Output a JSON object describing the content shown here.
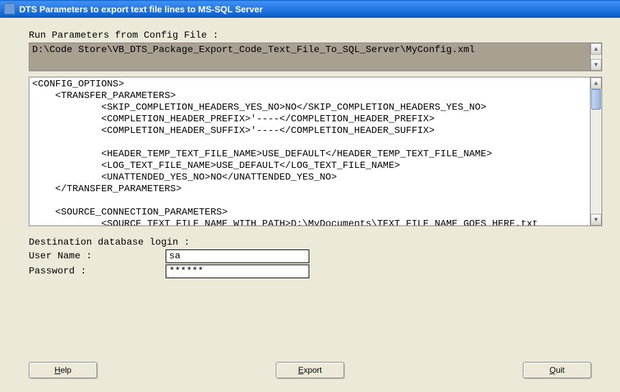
{
  "window": {
    "title": "DTS Parameters to export text file lines to MS-SQL Server"
  },
  "labels": {
    "run_params": "Run Parameters from Config File :",
    "dest_login": "Destination database login :",
    "user_name": "User Name :",
    "password": "Password :"
  },
  "config_path": "D:\\Code Store\\VB_DTS_Package_Export_Code_Text_File_To_SQL_Server\\MyConfig.xml",
  "xml_content": "<CONFIG_OPTIONS>\n    <TRANSFER_PARAMETERS>\n            <SKIP_COMPLETION_HEADERS_YES_NO>NO</SKIP_COMPLETION_HEADERS_YES_NO>\n            <COMPLETION_HEADER_PREFIX>'----</COMPLETION_HEADER_PREFIX>\n            <COMPLETION_HEADER_SUFFIX>'----</COMPLETION_HEADER_SUFFIX>\n\n            <HEADER_TEMP_TEXT_FILE_NAME>USE_DEFAULT</HEADER_TEMP_TEXT_FILE_NAME>\n            <LOG_TEXT_FILE_NAME>USE_DEFAULT</LOG_TEXT_FILE_NAME>\n            <UNATTENDED_YES_NO>NO</UNATTENDED_YES_NO>\n    </TRANSFER_PARAMETERS>\n\n    <SOURCE_CONNECTION_PARAMETERS>\n            <SOURCE_TEXT_FILE_NAME_WITH_PATH>D:\\MyDocuments\\TEXT_FILE_NAME_GOES_HERE.txt\n</SOURCE_TEXT_FILE_NAME_WITH_PATH>\n            <SOURCE_FOLDERS_LIST_SEP_CHAR>|</SOURCE_FOLDERS_LIST_SEP_CHAR>\n            <SOURCE_FOLDERS_LIST>D:\\Project_SaiGrace</SOURCE_FOLDERS_LIST>\n            <SOURCE_FILES_EXCLUSION_LIST_SEP_CHAR>|</SOURCE_FILES_EXCLUSION_LIST_SEP_CHAR>",
  "login": {
    "username": "sa",
    "password": "******"
  },
  "buttons": {
    "help": "elp",
    "help_u": "H",
    "export": "xport",
    "export_u": "E",
    "quit": "uit",
    "quit_u": "Q"
  }
}
